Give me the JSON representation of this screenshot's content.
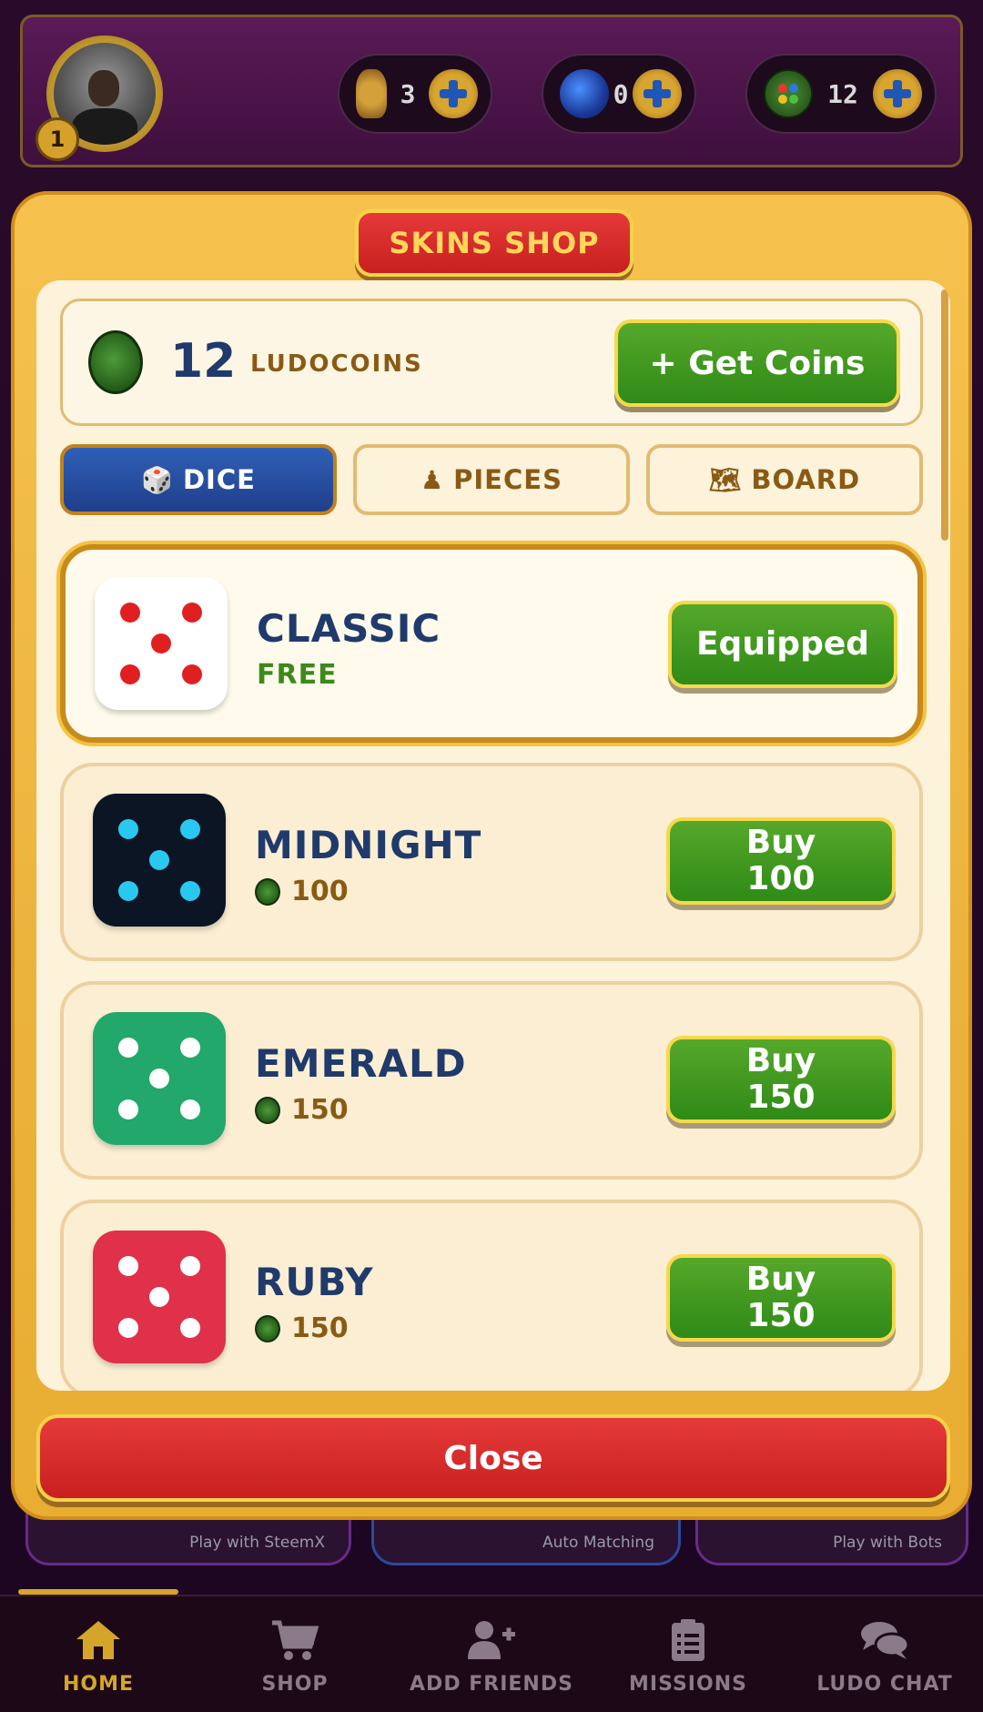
{
  "topbar": {
    "level": "1",
    "currencies": [
      {
        "icon": "trophy-icon",
        "value": "3"
      },
      {
        "icon": "steem-icon",
        "value": "0"
      },
      {
        "icon": "ludocoin-icon",
        "value": "12"
      }
    ]
  },
  "background_cards": [
    {
      "label": "Play with SteemX"
    },
    {
      "label": "Auto Matching"
    },
    {
      "label": "Play with Bots"
    }
  ],
  "shop": {
    "title": "SKINS SHOP",
    "balance": {
      "amount": "12",
      "unit": "LUDOCOINS"
    },
    "get_coins_label": "+ Get Coins",
    "tabs": [
      {
        "label": "DICE",
        "icon": "dice-icon",
        "active": true
      },
      {
        "label": "PIECES",
        "icon": "pawn-icon",
        "active": false
      },
      {
        "label": "BOARD",
        "icon": "map-icon",
        "active": false
      }
    ],
    "items": [
      {
        "name": "CLASSIC",
        "price": "FREE",
        "button": "Equipped",
        "equipped": true,
        "face_color": "#ffffff",
        "pip_color": "#e02020"
      },
      {
        "name": "MIDNIGHT",
        "price": "100",
        "button_l1": "Buy",
        "button_l2": "100",
        "equipped": false,
        "face_color": "#0c1524",
        "pip_color": "#29c8f0"
      },
      {
        "name": "EMERALD",
        "price": "150",
        "button_l1": "Buy",
        "button_l2": "150",
        "equipped": false,
        "face_color": "#21a86a",
        "pip_color": "#ffffff"
      },
      {
        "name": "RUBY",
        "price": "150",
        "button_l1": "Buy",
        "button_l2": "150",
        "equipped": false,
        "face_color": "#e0304a",
        "pip_color": "#ffffff"
      }
    ],
    "close_label": "Close"
  },
  "nav": {
    "items": [
      {
        "label": "HOME",
        "icon": "home-icon",
        "active": true
      },
      {
        "label": "SHOP",
        "icon": "cart-icon",
        "active": false
      },
      {
        "label": "ADD FRIENDS",
        "icon": "add-user-icon",
        "active": false
      },
      {
        "label": "MISSIONS",
        "icon": "clipboard-icon",
        "active": false
      },
      {
        "label": "LUDO CHAT",
        "icon": "chat-icon",
        "active": false
      }
    ]
  },
  "colors": {
    "accent_gold": "#f6c24d",
    "button_green": "#2f8a17",
    "button_red": "#c81f1f",
    "tab_blue": "#1f3f8a",
    "text_navy": "#1f3a6b"
  }
}
